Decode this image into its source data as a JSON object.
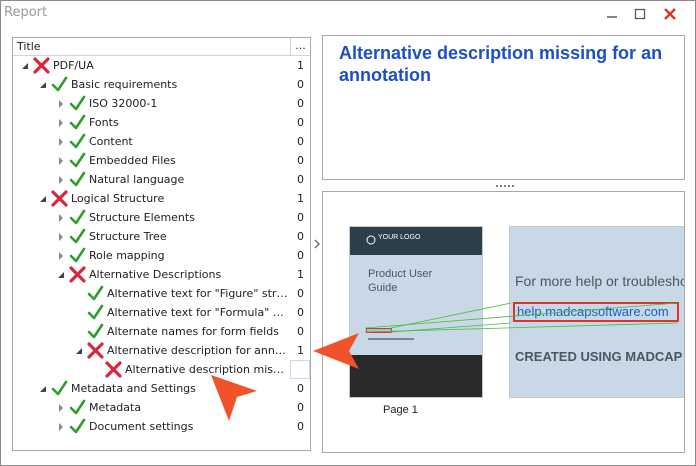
{
  "window": {
    "title": "Report",
    "controls": [
      "minimize-icon",
      "maximize-icon",
      "close-icon"
    ],
    "close_color": "#e0322a"
  },
  "tree": {
    "columns": {
      "title": "Title",
      "more": "..."
    },
    "rows": [
      {
        "label": "PDF/UA",
        "count": "1",
        "status": "fail",
        "level": 0,
        "expanded": true
      },
      {
        "label": "Basic requirements",
        "count": "0",
        "status": "pass",
        "level": 1,
        "expanded": true
      },
      {
        "label": "ISO 32000-1",
        "count": "0",
        "status": "pass",
        "level": 2,
        "expanded": false
      },
      {
        "label": "Fonts",
        "count": "0",
        "status": "pass",
        "level": 2,
        "expanded": false
      },
      {
        "label": "Content",
        "count": "0",
        "status": "pass",
        "level": 2,
        "expanded": false
      },
      {
        "label": "Embedded Files",
        "count": "0",
        "status": "pass",
        "level": 2,
        "expanded": false
      },
      {
        "label": "Natural language",
        "count": "0",
        "status": "pass",
        "level": 2,
        "expanded": false
      },
      {
        "label": "Logical Structure",
        "count": "1",
        "status": "fail",
        "level": 1,
        "expanded": true
      },
      {
        "label": "Structure Elements",
        "count": "0",
        "status": "pass",
        "level": 2,
        "expanded": false
      },
      {
        "label": "Structure Tree",
        "count": "0",
        "status": "pass",
        "level": 2,
        "expanded": false
      },
      {
        "label": "Role mapping",
        "count": "0",
        "status": "pass",
        "level": 2,
        "expanded": false
      },
      {
        "label": "Alternative Descriptions",
        "count": "1",
        "status": "fail",
        "level": 2,
        "expanded": true
      },
      {
        "label": "Alternative text for \"Figure\" struct...",
        "count": "0",
        "status": "pass",
        "level": 3,
        "expanded": null
      },
      {
        "label": "Alternative text for \"Formula\" stru...",
        "count": "0",
        "status": "pass",
        "level": 3,
        "expanded": null
      },
      {
        "label": "Alternate names for form fields",
        "count": "0",
        "status": "pass",
        "level": 3,
        "expanded": null
      },
      {
        "label": "Alternative description for annotati...",
        "count": "1",
        "status": "fail",
        "level": 3,
        "expanded": true
      },
      {
        "label": "Alternative description missing ...",
        "count": "",
        "status": "fail",
        "level": 4,
        "expanded": null,
        "selected": true
      },
      {
        "label": "Metadata and Settings",
        "count": "0",
        "status": "pass",
        "level": 1,
        "expanded": true
      },
      {
        "label": "Metadata",
        "count": "0",
        "status": "pass",
        "level": 2,
        "expanded": false
      },
      {
        "label": "Document settings",
        "count": "0",
        "status": "pass",
        "level": 2,
        "expanded": false
      }
    ]
  },
  "description": {
    "title": "Alternative description missing for an annotation",
    "title_color": "#1c4fc6"
  },
  "preview": {
    "thumbnail": {
      "logo_text": "YOUR LOGO",
      "title_line1": "Product User",
      "title_line2": "Guide",
      "page_label": "Page 1"
    },
    "zoom": {
      "help_text": "For more help or troubleshooting",
      "link_text": "help.madcapsoftware.com",
      "created_text": "CREATED USING MADCAP FLARE"
    },
    "highlight_color": "#e0322a",
    "connector_color": "#3fbf3f"
  },
  "icons": {
    "pass": "check-icon",
    "fail": "cross-icon",
    "splitter": "chevron-right-icon",
    "pointer": "orange-arrow-pointer-icon"
  },
  "accent_orange": "#f0532a"
}
